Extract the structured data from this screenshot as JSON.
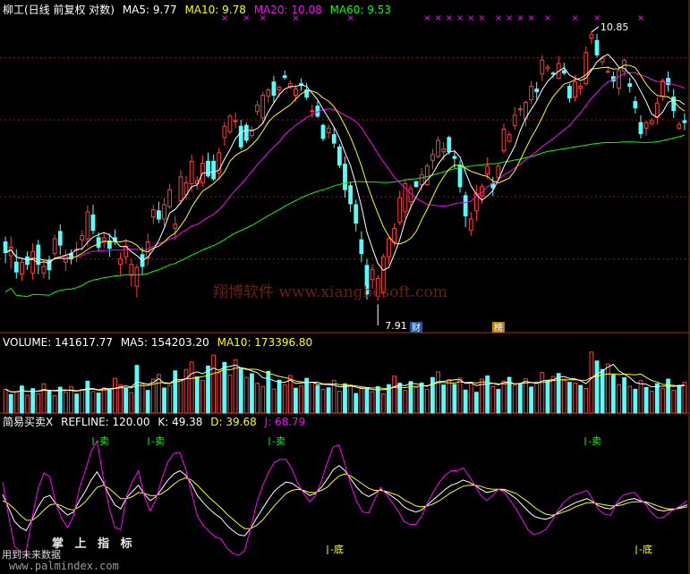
{
  "chart_data": {
    "type": "candlestick",
    "price_header": {
      "title": "柳工(日线 前复权 对数)",
      "ma5": "MA5: 9.77",
      "ma10": "MA10: 9.78",
      "ma20": "MA20: 10.08",
      "ma60": "MA60: 9.53"
    },
    "high_label": "10.85",
    "low_label": "7.91",
    "badges": [
      "财",
      "榜"
    ],
    "volume_header": {
      "title": "VOLUME: 141617.77",
      "ma5": "MA5: 154203.20",
      "ma10": "MA10: 173396.80"
    },
    "indicator_header": {
      "title": "简易买卖X",
      "refline": "REFLINE: 120.00",
      "k": "K: 49.38",
      "d": "D: 39.68",
      "j": "J: 68.79"
    },
    "sell_label": "卖",
    "bottom_label": "底",
    "watermark": "翔博软件 www.xiangbosoft.com",
    "bottom_text": {
      "a": "掌 上 指 标",
      "b": "用到未来数据",
      "c": "www.palmindex.com"
    },
    "colors": {
      "up": "#ff3c3c",
      "down": "#54ffff",
      "ma5": "#ffffff",
      "ma10": "#ffff00",
      "ma20": "#ff00ff",
      "ma60": "#00ff00"
    },
    "candles": [
      [
        8.56,
        8.46,
        8.61,
        8.36
      ],
      [
        8.43,
        8.51,
        8.61,
        8.31
      ],
      [
        8.37,
        8.28,
        8.49,
        8.22
      ],
      [
        8.26,
        8.37,
        8.41,
        8.2
      ],
      [
        8.42,
        8.35,
        8.47,
        8.3
      ],
      [
        8.27,
        8.47,
        8.55,
        8.21
      ],
      [
        8.53,
        8.35,
        8.58,
        8.26
      ],
      [
        8.27,
        8.33,
        8.4,
        8.22
      ],
      [
        8.39,
        8.3,
        8.43,
        8.21
      ],
      [
        8.45,
        8.59,
        8.63,
        8.42
      ],
      [
        8.66,
        8.53,
        8.73,
        8.44
      ],
      [
        8.37,
        8.43,
        8.49,
        8.29
      ],
      [
        8.45,
        8.4,
        8.49,
        8.35
      ],
      [
        8.48,
        8.49,
        8.56,
        8.37
      ],
      [
        8.58,
        8.62,
        8.67,
        8.48
      ],
      [
        8.59,
        8.85,
        8.91,
        8.52
      ],
      [
        8.82,
        8.67,
        8.92,
        8.63
      ],
      [
        8.6,
        8.51,
        8.65,
        8.47
      ],
      [
        8.56,
        8.6,
        8.65,
        8.5
      ],
      [
        8.57,
        8.5,
        8.64,
        8.42
      ],
      [
        8.6,
        8.57,
        8.68,
        8.53
      ],
      [
        8.35,
        8.4,
        8.46,
        8.25
      ],
      [
        8.42,
        8.52,
        8.59,
        8.36
      ],
      [
        8.25,
        8.35,
        8.4,
        8.15
      ],
      [
        8.15,
        8.32,
        8.35,
        8.05
      ],
      [
        8.44,
        8.33,
        8.51,
        8.25
      ],
      [
        8.41,
        8.56,
        8.64,
        8.34
      ],
      [
        8.8,
        8.87,
        8.92,
        8.73
      ],
      [
        8.86,
        8.78,
        8.95,
        8.74
      ],
      [
        8.78,
        8.92,
        8.99,
        8.71
      ],
      [
        8.9,
        9.07,
        9.13,
        8.88
      ],
      [
        8.69,
        8.73,
        8.81,
        8.58
      ],
      [
        8.96,
        9.2,
        9.27,
        8.92
      ],
      [
        9.02,
        9.14,
        9.21,
        8.97
      ],
      [
        9.13,
        9.36,
        9.43,
        9.05
      ],
      [
        9.13,
        9.16,
        9.21,
        9.07
      ],
      [
        9.14,
        9.34,
        9.42,
        9.1
      ],
      [
        9.36,
        9.21,
        9.45,
        9.19
      ],
      [
        9.36,
        9.18,
        9.43,
        9.16
      ],
      [
        9.24,
        9.45,
        9.5,
        9.17
      ],
      [
        9.61,
        9.73,
        9.78,
        9.52
      ],
      [
        9.67,
        9.84,
        9.86,
        9.65
      ],
      [
        9.78,
        9.79,
        9.88,
        9.71
      ],
      [
        9.73,
        9.51,
        9.8,
        9.48
      ],
      [
        9.74,
        9.58,
        9.77,
        9.55
      ],
      [
        9.63,
        9.69,
        9.73,
        9.61
      ],
      [
        9.89,
        9.96,
        10.01,
        9.85
      ],
      [
        9.82,
        10.07,
        10.11,
        9.75
      ],
      [
        10.06,
        10.13,
        10.15,
        9.99
      ],
      [
        10.22,
        10.07,
        10.29,
        9.99
      ],
      [
        10.13,
        10.16,
        10.18,
        10.05
      ],
      [
        10.29,
        10.27,
        10.35,
        10.25
      ],
      [
        10.17,
        10.2,
        10.24,
        10.14
      ],
      [
        10.07,
        10.14,
        10.19,
        10.0
      ],
      [
        10.2,
        10.18,
        10.26,
        10.12
      ],
      [
        10.13,
        10.05,
        10.21,
        10.02
      ],
      [
        9.89,
        9.9,
        9.97,
        9.82
      ],
      [
        9.95,
        9.84,
        10.01,
        9.82
      ],
      [
        9.74,
        9.6,
        9.76,
        9.57
      ],
      [
        9.66,
        9.71,
        9.75,
        9.6
      ],
      [
        9.64,
        9.55,
        9.72,
        9.5
      ],
      [
        9.51,
        9.32,
        9.54,
        9.29
      ],
      [
        9.33,
        9.07,
        9.41,
        8.99
      ],
      [
        9.11,
        8.93,
        9.15,
        8.85
      ],
      [
        8.92,
        8.74,
        8.97,
        8.66
      ],
      [
        8.58,
        8.45,
        8.66,
        8.37
      ],
      [
        8.34,
        8.08,
        8.4,
        8.03
      ],
      [
        8.21,
        8.3,
        8.35,
        8.13
      ],
      [
        8.06,
        8.22,
        8.25,
        8.02
      ],
      [
        8.09,
        8.42,
        8.45,
        8.05
      ],
      [
        8.42,
        8.59,
        8.6,
        8.35
      ],
      [
        8.56,
        8.69,
        8.74,
        8.52
      ],
      [
        8.75,
        8.99,
        9.06,
        8.72
      ],
      [
        8.85,
        9.13,
        9.18,
        8.79
      ],
      [
        8.95,
        9.08,
        9.12,
        8.87
      ],
      [
        9.15,
        9.1,
        9.16,
        9.13
      ],
      [
        9.12,
        9.22,
        9.29,
        9.06
      ],
      [
        9.12,
        9.31,
        9.34,
        9.11
      ],
      [
        9.37,
        9.43,
        9.49,
        9.28
      ],
      [
        9.41,
        9.58,
        9.62,
        9.39
      ],
      [
        9.46,
        9.49,
        9.56,
        9.37
      ],
      [
        9.61,
        9.46,
        9.63,
        9.43
      ],
      [
        9.41,
        9.39,
        9.47,
        9.29
      ],
      [
        9.32,
        9.1,
        9.37,
        9.04
      ],
      [
        9.01,
        8.81,
        9.05,
        8.7
      ],
      [
        8.67,
        8.78,
        8.85,
        8.62
      ],
      [
        8.86,
        9.03,
        9.12,
        8.76
      ],
      [
        9.01,
        9.1,
        9.13,
        8.93
      ],
      [
        9.23,
        9.31,
        9.4,
        9.18
      ],
      [
        9.13,
        9.09,
        9.2,
        9.01
      ],
      [
        9.19,
        9.31,
        9.34,
        9.17
      ],
      [
        9.47,
        9.7,
        9.76,
        9.44
      ],
      [
        9.57,
        9.64,
        9.67,
        9.56
      ],
      [
        9.74,
        9.85,
        9.94,
        9.69
      ],
      [
        9.91,
        9.92,
        9.96,
        9.84
      ],
      [
        9.81,
        9.99,
        10.01,
        9.73
      ],
      [
        10.02,
        10.17,
        10.23,
        9.97
      ],
      [
        10.14,
        10.11,
        10.22,
        10.02
      ],
      [
        10.31,
        10.47,
        10.53,
        10.23
      ],
      [
        10.37,
        10.39,
        10.42,
        10.33
      ],
      [
        10.32,
        10.31,
        10.34,
        10.27
      ],
      [
        10.26,
        10.43,
        10.52,
        10.25
      ],
      [
        10.35,
        10.32,
        10.44,
        10.3
      ],
      [
        10.17,
        10.04,
        10.2,
        9.99
      ],
      [
        10.05,
        10.22,
        10.3,
        10.0
      ],
      [
        10.15,
        10.17,
        10.21,
        10.07
      ],
      [
        10.2,
        10.56,
        10.63,
        10.18
      ],
      [
        10.73,
        10.77,
        10.8,
        10.66
      ],
      [
        10.7,
        10.53,
        10.78,
        10.5
      ],
      [
        10.45,
        10.49,
        10.52,
        10.41
      ],
      [
        10.33,
        10.34,
        10.4,
        10.33
      ],
      [
        10.28,
        10.23,
        10.34,
        10.15
      ],
      [
        10.15,
        10.35,
        10.39,
        10.07
      ],
      [
        10.34,
        10.47,
        10.49,
        10.29
      ],
      [
        10.2,
        10.17,
        10.27,
        10.1
      ],
      [
        10.0,
        9.93,
        10.06,
        9.87
      ],
      [
        9.77,
        9.65,
        9.85,
        9.6
      ],
      [
        9.71,
        9.77,
        9.79,
        9.63
      ],
      [
        9.76,
        9.79,
        9.82,
        9.74
      ],
      [
        9.83,
        9.98,
        10.05,
        9.75
      ],
      [
        10.06,
        10.23,
        10.26,
        10.01
      ],
      [
        10.26,
        10.19,
        10.34,
        10.11
      ],
      [
        10.05,
        9.9,
        10.14,
        9.82
      ],
      [
        9.71,
        9.75,
        9.78,
        9.69
      ],
      [
        9.79,
        9.77,
        9.87,
        9.69
      ]
    ],
    "volumes": [
      [
        118000,
        1
      ],
      [
        92000,
        0
      ],
      [
        105000,
        1
      ],
      [
        134000,
        0
      ],
      [
        88000,
        1
      ],
      [
        121000,
        0
      ],
      [
        97000,
        1
      ],
      [
        145000,
        1
      ],
      [
        112000,
        0
      ],
      [
        86000,
        1
      ],
      [
        128000,
        0
      ],
      [
        103000,
        1
      ],
      [
        131000,
        1
      ],
      [
        94000,
        0
      ],
      [
        117000,
        1
      ],
      [
        158000,
        0
      ],
      [
        107000,
        1
      ],
      [
        99000,
        0
      ],
      [
        125000,
        1
      ],
      [
        113000,
        0
      ],
      [
        172000,
        1
      ],
      [
        139000,
        1
      ],
      [
        124000,
        0
      ],
      [
        101000,
        1
      ],
      [
        236000,
        0
      ],
      [
        143000,
        1
      ],
      [
        112000,
        0
      ],
      [
        168000,
        1
      ],
      [
        191000,
        1
      ],
      [
        124000,
        0
      ],
      [
        137000,
        1
      ],
      [
        209000,
        0
      ],
      [
        164000,
        1
      ],
      [
        216000,
        1
      ],
      [
        253000,
        1
      ],
      [
        179000,
        0
      ],
      [
        162000,
        1
      ],
      [
        233000,
        0
      ],
      [
        287000,
        1
      ],
      [
        199000,
        1
      ],
      [
        251000,
        0
      ],
      [
        189000,
        1
      ],
      [
        263000,
        1
      ],
      [
        218000,
        0
      ],
      [
        177000,
        1
      ],
      [
        195000,
        0
      ],
      [
        148000,
        1
      ],
      [
        132000,
        1
      ],
      [
        207000,
        0
      ],
      [
        119000,
        1
      ],
      [
        163000,
        0
      ],
      [
        141000,
        1
      ],
      [
        186000,
        1
      ],
      [
        123000,
        0
      ],
      [
        134000,
        1
      ],
      [
        172000,
        0
      ],
      [
        151000,
        1
      ],
      [
        136000,
        0
      ],
      [
        117000,
        1
      ],
      [
        125000,
        0
      ],
      [
        162000,
        1
      ],
      [
        108000,
        1
      ],
      [
        145000,
        0
      ],
      [
        133000,
        1
      ],
      [
        97000,
        0
      ],
      [
        126000,
        1
      ],
      [
        119000,
        0
      ],
      [
        106000,
        1
      ],
      [
        131000,
        0
      ],
      [
        95000,
        1
      ],
      [
        141000,
        0
      ],
      [
        183000,
        1
      ],
      [
        148000,
        0
      ],
      [
        112000,
        1
      ],
      [
        156000,
        0
      ],
      [
        127000,
        1
      ],
      [
        149000,
        0
      ],
      [
        118000,
        1
      ],
      [
        176000,
        0
      ],
      [
        204000,
        1
      ],
      [
        139000,
        0
      ],
      [
        166000,
        1
      ],
      [
        142000,
        0
      ],
      [
        173000,
        1
      ],
      [
        114000,
        0
      ],
      [
        151000,
        1
      ],
      [
        103000,
        0
      ],
      [
        168000,
        1
      ],
      [
        184000,
        0
      ],
      [
        131000,
        1
      ],
      [
        117000,
        0
      ],
      [
        159000,
        1
      ],
      [
        177000,
        0
      ],
      [
        138000,
        1
      ],
      [
        143000,
        0
      ],
      [
        169000,
        1
      ],
      [
        129000,
        0
      ],
      [
        154000,
        1
      ],
      [
        201000,
        1
      ],
      [
        159000,
        0
      ],
      [
        181000,
        1
      ],
      [
        196000,
        0
      ],
      [
        168000,
        1
      ],
      [
        152000,
        0
      ],
      [
        149000,
        1
      ],
      [
        137000,
        0
      ],
      [
        122000,
        1
      ],
      [
        302000,
        1
      ],
      [
        258000,
        0
      ],
      [
        216000,
        0
      ],
      [
        243000,
        1
      ],
      [
        188000,
        0
      ],
      [
        141000,
        1
      ],
      [
        175000,
        0
      ],
      [
        133000,
        1
      ],
      [
        118000,
        0
      ],
      [
        162000,
        1
      ],
      [
        127000,
        0
      ],
      [
        109000,
        1
      ],
      [
        146000,
        0
      ],
      [
        121000,
        1
      ],
      [
        168000,
        0
      ],
      [
        113000,
        1
      ],
      [
        137000,
        0
      ],
      [
        152000,
        1
      ]
    ],
    "indicator": {
      "k": [
        61,
        48,
        35,
        29,
        26,
        37,
        49,
        58,
        60,
        52,
        46,
        41,
        44,
        55,
        64,
        75,
        83,
        73,
        61,
        51,
        47,
        58,
        64,
        70,
        61,
        55,
        59,
        67,
        75,
        81,
        84,
        80,
        71,
        60,
        53,
        47,
        42,
        38,
        31,
        26,
        22,
        21,
        28,
        38,
        47,
        56,
        64,
        69,
        73,
        72,
        68,
        64,
        60,
        62,
        68,
        76,
        85,
        89,
        84,
        76,
        68,
        62,
        59,
        62,
        66,
        63,
        59,
        55,
        49,
        46,
        44,
        46,
        51,
        56,
        61,
        66,
        70,
        72,
        75,
        73,
        70,
        66,
        63,
        64,
        66,
        65,
        61,
        57,
        51,
        45,
        40,
        38,
        37,
        39,
        43,
        47,
        50,
        53,
        55,
        57,
        54,
        50,
        48,
        47,
        51,
        54,
        56,
        57,
        55,
        53,
        49,
        46,
        45,
        46,
        47,
        49,
        51
      ],
      "d": [
        55,
        52,
        47,
        41,
        36,
        36,
        40,
        46,
        51,
        52,
        50,
        47,
        46,
        49,
        54,
        61,
        68,
        70,
        67,
        62,
        57,
        57,
        59,
        63,
        62,
        60,
        60,
        62,
        66,
        71,
        75,
        77,
        75,
        70,
        64,
        58,
        53,
        48,
        42,
        37,
        32,
        28,
        28,
        31,
        36,
        43,
        50,
        56,
        62,
        65,
        66,
        65,
        63,
        63,
        65,
        68,
        74,
        79,
        81,
        79,
        75,
        71,
        67,
        65,
        65,
        64,
        62,
        60,
        56,
        53,
        50,
        49,
        50,
        52,
        55,
        59,
        63,
        66,
        69,
        70,
        70,
        69,
        67,
        66,
        66,
        66,
        64,
        62,
        58,
        54,
        49,
        45,
        42,
        41,
        42,
        44,
        46,
        49,
        51,
        53,
        53,
        52,
        51,
        50,
        50,
        51,
        53,
        54,
        54,
        54,
        52,
        50,
        48,
        47,
        47,
        48,
        49
      ],
      "j": [
        73,
        40,
        11,
        5,
        6,
        39,
        67,
        82,
        78,
        52,
        38,
        29,
        40,
        67,
        84,
        103,
        113,
        79,
        49,
        29,
        27,
        60,
        74,
        84,
        59,
        45,
        57,
        77,
        93,
        101,
        102,
        86,
        63,
        40,
        31,
        25,
        20,
        18,
        9,
        4,
        2,
        7,
        28,
        52,
        69,
        82,
        92,
        95,
        95,
        86,
        72,
        62,
        54,
        60,
        74,
        92,
        107,
        109,
        90,
        70,
        54,
        44,
        43,
        56,
        68,
        61,
        53,
        45,
        35,
        32,
        32,
        40,
        53,
        64,
        73,
        80,
        84,
        84,
        87,
        79,
        70,
        60,
        55,
        60,
        66,
        63,
        55,
        47,
        37,
        27,
        22,
        24,
        27,
        35,
        45,
        53,
        58,
        61,
        63,
        65,
        56,
        46,
        42,
        41,
        53,
        60,
        62,
        63,
        57,
        51,
        43,
        38,
        39,
        44,
        47,
        51,
        55
      ]
    }
  }
}
